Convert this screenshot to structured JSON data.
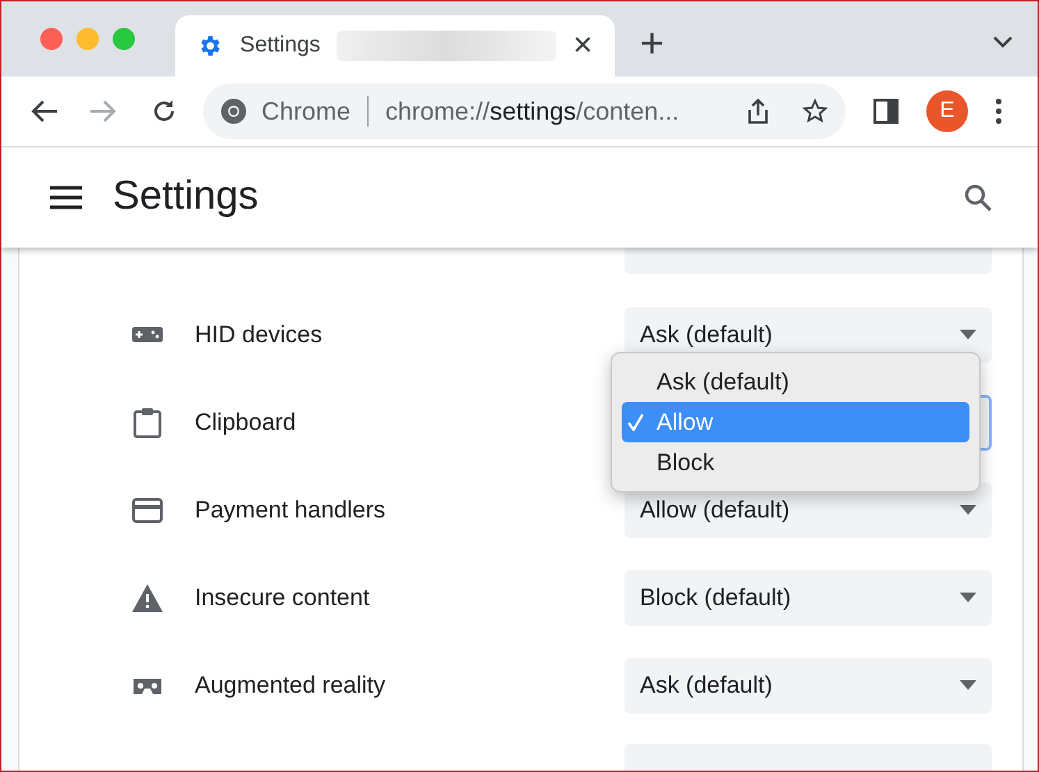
{
  "tab": {
    "title": "Settings",
    "close": "×"
  },
  "new_tab": "+",
  "omnibox": {
    "site": "Chrome",
    "url_prefix": "chrome://",
    "url_host": "settings",
    "url_rest": "/conten..."
  },
  "profile": {
    "initial": "E"
  },
  "header": {
    "title": "Settings"
  },
  "rows": [
    {
      "kind": "gamepad",
      "label": "HID devices",
      "value": "Ask (default)",
      "focused": false
    },
    {
      "kind": "clipboard",
      "label": "Clipboard",
      "value": "",
      "focused": true
    },
    {
      "kind": "card",
      "label": "Payment handlers",
      "value": "Allow (default)",
      "focused": false
    },
    {
      "kind": "warning",
      "label": "Insecure content",
      "value": "Block (default)",
      "focused": false
    },
    {
      "kind": "goggles",
      "label": "Augmented reality",
      "value": "Ask (default)",
      "focused": false
    }
  ],
  "dropdown_menu": [
    {
      "label": "Ask (default)",
      "selected": false
    },
    {
      "label": "Allow",
      "selected": true
    },
    {
      "label": "Block",
      "selected": false
    }
  ]
}
